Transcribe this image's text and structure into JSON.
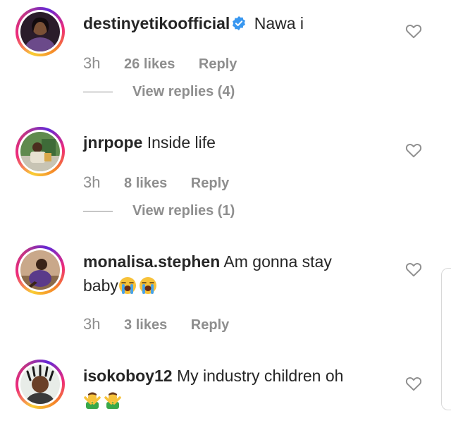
{
  "colors": {
    "text": "#262626",
    "muted": "#8e8e8e",
    "verified": "#3897f0",
    "background": "#ffffff"
  },
  "comments": [
    {
      "username": "destinyetikoofficial",
      "verified": true,
      "text": "Nawa i",
      "time": "3h",
      "likes": "26 likes",
      "reply": "Reply",
      "view_replies": "View replies (4)",
      "icons": [
        "verified-badge-icon",
        "heart-outline-icon"
      ]
    },
    {
      "username": "jnrpope",
      "verified": false,
      "text": "Inside life",
      "time": "3h",
      "likes": "8 likes",
      "reply": "Reply",
      "view_replies": "View replies (1)",
      "icons": [
        "heart-outline-icon"
      ]
    },
    {
      "username": "monalisa.stephen",
      "verified": false,
      "text_line1": "Am gonna stay",
      "text_line2": "baby",
      "emoji": [
        "loudly-crying-face",
        "loudly-crying-face"
      ],
      "time": "3h",
      "likes": "3 likes",
      "reply": "Reply",
      "icons": [
        "heart-outline-icon"
      ]
    },
    {
      "username": "isokoboy12",
      "verified": false,
      "text": "My industry children oh",
      "emoji": [
        "man-gesturing-no",
        "man-gesturing-no"
      ],
      "icons": [
        "heart-outline-icon"
      ]
    }
  ]
}
